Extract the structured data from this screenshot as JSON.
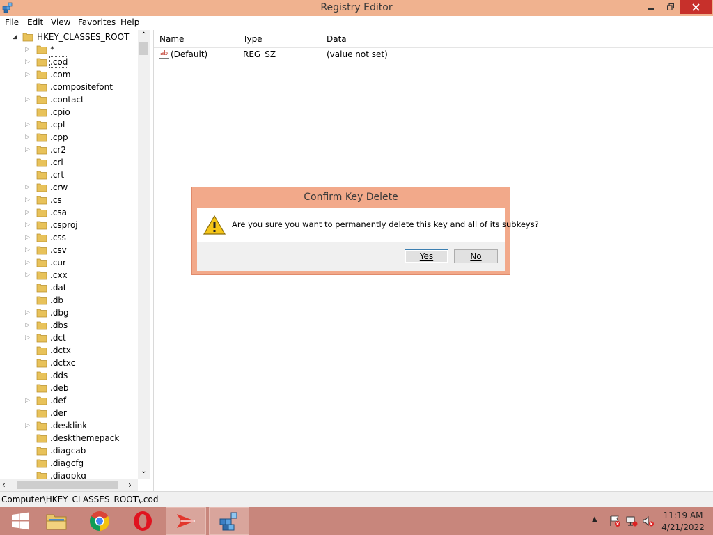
{
  "window": {
    "title": "Registry Editor"
  },
  "menu": [
    "File",
    "Edit",
    "View",
    "Favorites",
    "Help"
  ],
  "tree": {
    "root": "HKEY_CLASSES_ROOT",
    "selected": ".cod",
    "items": [
      {
        "label": "*",
        "expandable": true
      },
      {
        "label": ".cod",
        "expandable": true
      },
      {
        "label": ".com",
        "expandable": true
      },
      {
        "label": ".compositefont",
        "expandable": false
      },
      {
        "label": ".contact",
        "expandable": true
      },
      {
        "label": ".cpio",
        "expandable": false
      },
      {
        "label": ".cpl",
        "expandable": true
      },
      {
        "label": ".cpp",
        "expandable": true
      },
      {
        "label": ".cr2",
        "expandable": true
      },
      {
        "label": ".crl",
        "expandable": false
      },
      {
        "label": ".crt",
        "expandable": false
      },
      {
        "label": ".crw",
        "expandable": true
      },
      {
        "label": ".cs",
        "expandable": true
      },
      {
        "label": ".csa",
        "expandable": true
      },
      {
        "label": ".csproj",
        "expandable": true
      },
      {
        "label": ".css",
        "expandable": true
      },
      {
        "label": ".csv",
        "expandable": true
      },
      {
        "label": ".cur",
        "expandable": true
      },
      {
        "label": ".cxx",
        "expandable": true
      },
      {
        "label": ".dat",
        "expandable": false
      },
      {
        "label": ".db",
        "expandable": false
      },
      {
        "label": ".dbg",
        "expandable": true
      },
      {
        "label": ".dbs",
        "expandable": true
      },
      {
        "label": ".dct",
        "expandable": true
      },
      {
        "label": ".dctx",
        "expandable": false
      },
      {
        "label": ".dctxc",
        "expandable": false
      },
      {
        "label": ".dds",
        "expandable": false
      },
      {
        "label": ".deb",
        "expandable": false
      },
      {
        "label": ".def",
        "expandable": true
      },
      {
        "label": ".der",
        "expandable": false
      },
      {
        "label": ".desklink",
        "expandable": true
      },
      {
        "label": ".deskthemepack",
        "expandable": false
      },
      {
        "label": ".diagcab",
        "expandable": false
      },
      {
        "label": ".diagcfg",
        "expandable": false
      },
      {
        "label": ".diagpkg",
        "expandable": false
      }
    ]
  },
  "values": {
    "columns": [
      "Name",
      "Type",
      "Data"
    ],
    "rows": [
      {
        "name": "(Default)",
        "type": "REG_SZ",
        "data": "(value not set)",
        "icon": "string-value-icon"
      }
    ]
  },
  "status": {
    "path": "Computer\\HKEY_CLASSES_ROOT\\.cod"
  },
  "dialog": {
    "title": "Confirm Key Delete",
    "message": "Are you sure you want to permanently delete this key and all of its subkeys?",
    "yes_label": "Yes",
    "no_label": "No",
    "icon": "warning-icon"
  },
  "taskbar": {
    "items": [
      "start-button",
      "file-explorer",
      "chrome",
      "opera",
      "app-arrow",
      "registry-editor"
    ],
    "active": "registry-editor",
    "time": "11:19 AM",
    "date": "4/21/2022"
  },
  "colors": {
    "titlebar": "#f0b28f",
    "close": "#c7302b",
    "taskbar": "#c8867c",
    "dialog_frame": "#f2a98a"
  }
}
